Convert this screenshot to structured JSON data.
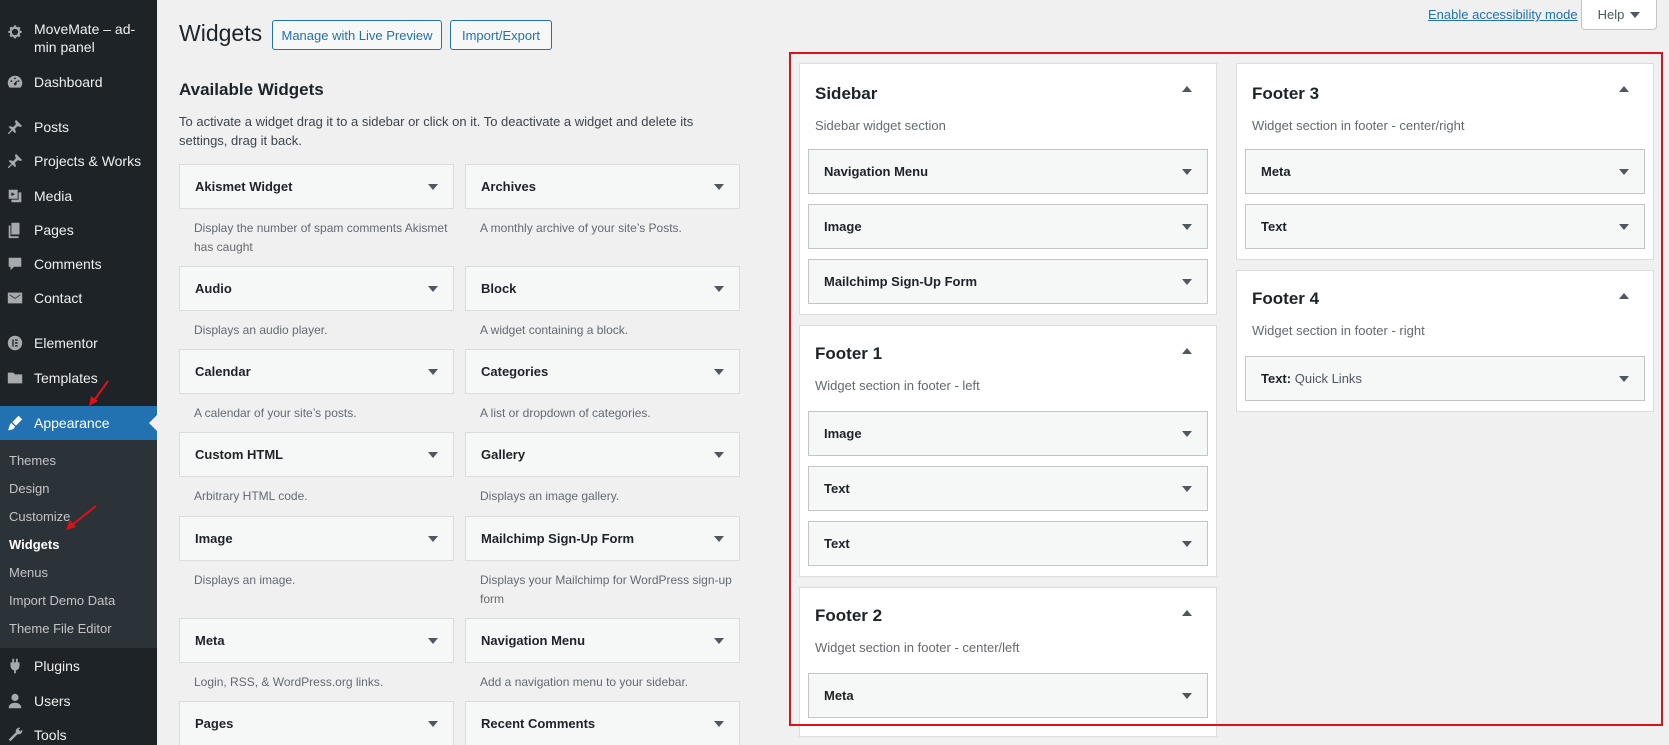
{
  "admin_menu": {
    "site_title": "MoveMate – ad-min panel",
    "items": [
      {
        "label": "Dashboard",
        "icon": "dashboard-icon"
      },
      {
        "label": "Posts",
        "icon": "pin-icon"
      },
      {
        "label": "Projects & Works",
        "icon": "pin-icon"
      },
      {
        "label": "Media",
        "icon": "media-icon"
      },
      {
        "label": "Pages",
        "icon": "page-icon"
      },
      {
        "label": "Comments",
        "icon": "comment-icon"
      },
      {
        "label": "Contact",
        "icon": "mail-icon"
      },
      {
        "label": "Elementor",
        "icon": "elementor-icon"
      },
      {
        "label": "Templates",
        "icon": "folder-icon"
      },
      {
        "label": "Appearance",
        "icon": "brush-icon"
      },
      {
        "label": "Plugins",
        "icon": "plugin-icon"
      },
      {
        "label": "Users",
        "icon": "user-icon"
      },
      {
        "label": "Tools",
        "icon": "wrench-icon"
      }
    ],
    "appearance_submenu": [
      "Themes",
      "Design",
      "Customize",
      "Widgets",
      "Menus",
      "Import Demo Data",
      "Theme File Editor"
    ]
  },
  "header": {
    "title": "Widgets",
    "manage_live_preview": "Manage with Live Preview",
    "import_export": "Import/Export",
    "accessibility_link": "Enable accessibility mode",
    "help": "Help"
  },
  "available": {
    "title": "Available Widgets",
    "description": "To activate a widget drag it to a sidebar or click on it. To deactivate a widget and delete its settings, drag it back.",
    "widgets": [
      {
        "name": "Akismet Widget",
        "desc": "Display the number of spam comments Akismet has caught"
      },
      {
        "name": "Archives",
        "desc": "A monthly archive of your site’s Posts."
      },
      {
        "name": "Audio",
        "desc": "Displays an audio player."
      },
      {
        "name": "Block",
        "desc": "A widget containing a block."
      },
      {
        "name": "Calendar",
        "desc": "A calendar of your site’s posts."
      },
      {
        "name": "Categories",
        "desc": "A list or dropdown of categories."
      },
      {
        "name": "Custom HTML",
        "desc": "Arbitrary HTML code."
      },
      {
        "name": "Gallery",
        "desc": "Displays an image gallery."
      },
      {
        "name": "Image",
        "desc": "Displays an image."
      },
      {
        "name": "Mailchimp Sign-Up Form",
        "desc": "Displays your Mailchimp for WordPress sign-up form"
      },
      {
        "name": "Meta",
        "desc": "Login, RSS, & WordPress.org links."
      },
      {
        "name": "Navigation Menu",
        "desc": "Add a navigation menu to your sidebar."
      },
      {
        "name": "Pages",
        "desc": ""
      },
      {
        "name": "Recent Comments",
        "desc": ""
      }
    ]
  },
  "areas": {
    "sidebar": {
      "title": "Sidebar",
      "desc": "Sidebar widget section",
      "widgets": [
        "Navigation Menu",
        "Image",
        "Mailchimp Sign-Up Form"
      ]
    },
    "footer1": {
      "title": "Footer 1",
      "desc": "Widget section in footer - left",
      "widgets": [
        "Image",
        "Text",
        "Text"
      ]
    },
    "footer2": {
      "title": "Footer 2",
      "desc": "Widget section in footer - center/left",
      "widgets": [
        "Meta"
      ]
    },
    "footer3": {
      "title": "Footer 3",
      "desc": "Widget section in footer - center/right",
      "widgets": [
        "Meta",
        "Text"
      ]
    },
    "footer4": {
      "title": "Footer 4",
      "desc": "Widget section in footer - right",
      "widget_name": "Text:",
      "widget_sub": "Quick Links"
    }
  },
  "colors": {
    "admin_bg": "#1d2327",
    "accent": "#2271b1",
    "highlight": "#e0101b"
  }
}
